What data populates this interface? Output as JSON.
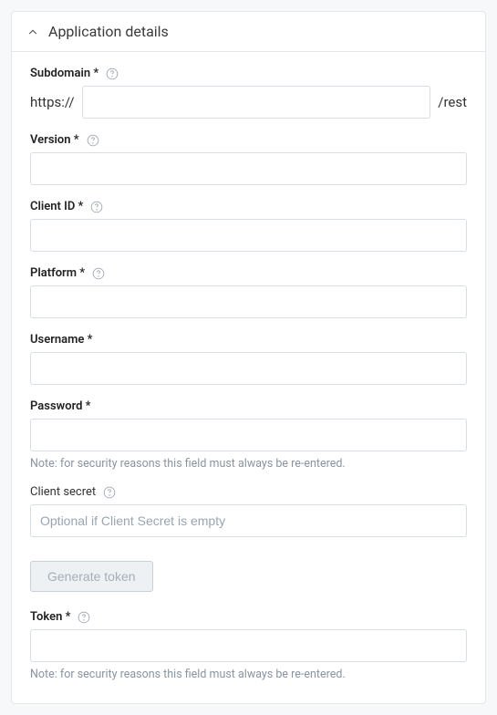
{
  "panel": {
    "title": "Application details"
  },
  "subdomain": {
    "label": "Subdomain *",
    "prefix": "https://",
    "suffix": "/rest",
    "value": ""
  },
  "version": {
    "label": "Version *",
    "value": ""
  },
  "client_id": {
    "label": "Client ID *",
    "value": ""
  },
  "platform": {
    "label": "Platform *",
    "value": ""
  },
  "username": {
    "label": "Username *",
    "value": ""
  },
  "password": {
    "label": "Password *",
    "value": "",
    "note": "Note: for security reasons this field must always be re-entered."
  },
  "client_secret": {
    "label": "Client secret",
    "placeholder": "Optional if Client Secret is empty",
    "value": ""
  },
  "generate_token": {
    "label": "Generate token"
  },
  "token": {
    "label": "Token *",
    "value": "",
    "note": "Note: for security reasons this field must always be re-entered."
  }
}
